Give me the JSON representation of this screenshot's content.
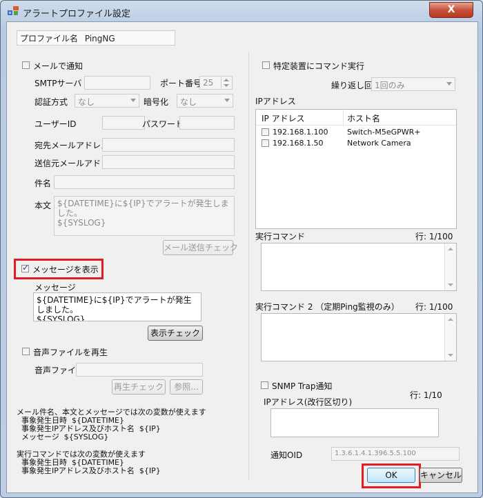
{
  "window": {
    "title": "アラートプロファイル設定",
    "close_label": "X"
  },
  "profile": {
    "label": "プロファイル名",
    "value": "PingNG"
  },
  "mail": {
    "checkbox_label": "メールで通知",
    "checked": false,
    "smtp_label": "SMTPサーバ",
    "smtp_value": "",
    "port_label": "ポート番号",
    "port_value": "25",
    "auth_label": "認証方式",
    "auth_value": "なし",
    "encrypt_label": "暗号化",
    "encrypt_value": "なし",
    "userid_label": "ユーザーID",
    "password_label": "パスワード",
    "to_label": "宛先メールアドレス",
    "from_label": "送信元メールアドレス",
    "subject_label": "件名",
    "body_label": "本文",
    "body_line1": "${DATETIME}に${IP}でアラートが発生しました。",
    "body_line2": "${SYSLOG}",
    "check_button": "メール送信チェック"
  },
  "message": {
    "checkbox_label": "メッセージを表示",
    "checked": true,
    "field_label": "メッセージ",
    "line1": "${DATETIME}に${IP}でアラートが発生しました。",
    "line2": "${SYSLOG}",
    "check_button": "表示チェック"
  },
  "sound": {
    "checkbox_label": "音声ファイルを再生",
    "checked": false,
    "file_label": "音声ファイル",
    "play_button": "再生チェック",
    "browse_button": "参照..."
  },
  "notes": {
    "block1": "メール件名、本文とメッセージでは次の変数が使えます\n  事象発生日時  ${DATETIME}\n  事象発生IPアドレス及びホスト名  ${IP}\n  メッセージ  ${SYSLOG}",
    "block2": "実行コマンドでは次の変数が使えます\n  事象発生日時  ${DATETIME}\n  事象発生IPアドレス及びホスト名  ${IP}"
  },
  "command": {
    "checkbox_label": "特定装置にコマンド実行",
    "checked": false,
    "repeat_label": "繰り返し回数",
    "repeat_value": "1回のみ",
    "ip_label": "IPアドレス",
    "columns": [
      "IP アドレス",
      "ホスト名"
    ],
    "rows": [
      {
        "ip": "192.168.1.100",
        "host": "Switch-M5eGPWR+"
      },
      {
        "ip": "192.168.1.50",
        "host": "Network Camera"
      }
    ],
    "exec_label": "実行コマンド",
    "exec_lines": "行: 1/100",
    "exec2_label": "実行コマンド 2 （定期Ping監視のみ）",
    "exec2_lines": "行: 1/100"
  },
  "snmp": {
    "checkbox_label": "SNMP Trap通知",
    "checked": false,
    "ip_label": "IPアドレス(改行区切り)",
    "lines": "行: 1/10",
    "oid_label": "通知OID",
    "oid_value": "1.3.6.1.4.1.396.5.5.100"
  },
  "buttons": {
    "ok": "OK",
    "cancel": "キャンセル"
  }
}
